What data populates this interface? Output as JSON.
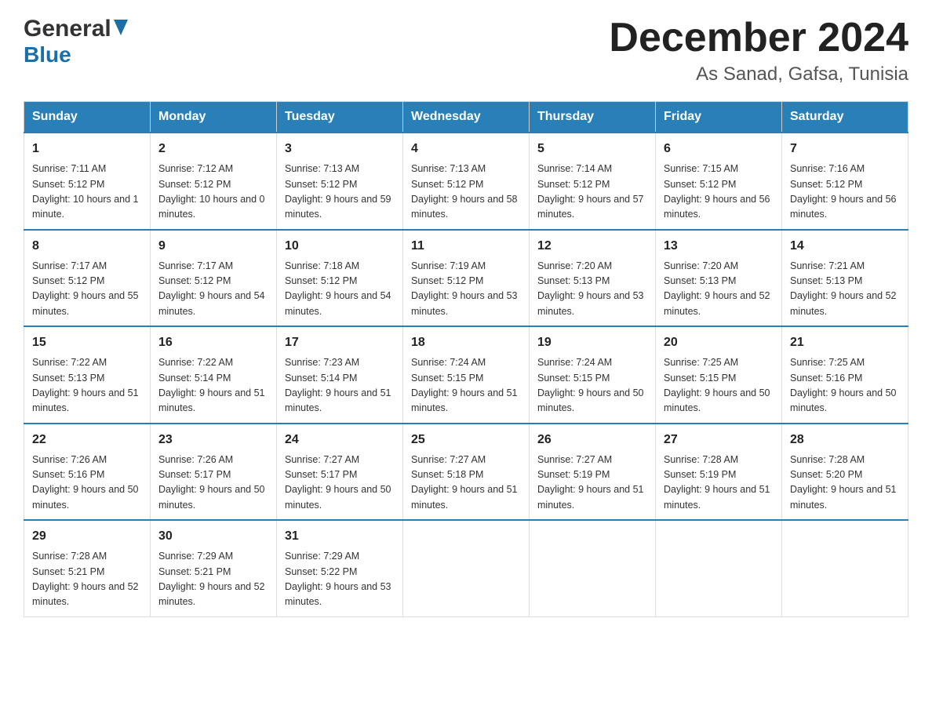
{
  "header": {
    "logo_line1": "General",
    "logo_line2": "Blue",
    "title": "December 2024",
    "subtitle": "As Sanad, Gafsa, Tunisia"
  },
  "days_of_week": [
    "Sunday",
    "Monday",
    "Tuesday",
    "Wednesday",
    "Thursday",
    "Friday",
    "Saturday"
  ],
  "weeks": [
    [
      {
        "day": "1",
        "sunrise": "7:11 AM",
        "sunset": "5:12 PM",
        "daylight": "10 hours and 1 minute."
      },
      {
        "day": "2",
        "sunrise": "7:12 AM",
        "sunset": "5:12 PM",
        "daylight": "10 hours and 0 minutes."
      },
      {
        "day": "3",
        "sunrise": "7:13 AM",
        "sunset": "5:12 PM",
        "daylight": "9 hours and 59 minutes."
      },
      {
        "day": "4",
        "sunrise": "7:13 AM",
        "sunset": "5:12 PM",
        "daylight": "9 hours and 58 minutes."
      },
      {
        "day": "5",
        "sunrise": "7:14 AM",
        "sunset": "5:12 PM",
        "daylight": "9 hours and 57 minutes."
      },
      {
        "day": "6",
        "sunrise": "7:15 AM",
        "sunset": "5:12 PM",
        "daylight": "9 hours and 56 minutes."
      },
      {
        "day": "7",
        "sunrise": "7:16 AM",
        "sunset": "5:12 PM",
        "daylight": "9 hours and 56 minutes."
      }
    ],
    [
      {
        "day": "8",
        "sunrise": "7:17 AM",
        "sunset": "5:12 PM",
        "daylight": "9 hours and 55 minutes."
      },
      {
        "day": "9",
        "sunrise": "7:17 AM",
        "sunset": "5:12 PM",
        "daylight": "9 hours and 54 minutes."
      },
      {
        "day": "10",
        "sunrise": "7:18 AM",
        "sunset": "5:12 PM",
        "daylight": "9 hours and 54 minutes."
      },
      {
        "day": "11",
        "sunrise": "7:19 AM",
        "sunset": "5:12 PM",
        "daylight": "9 hours and 53 minutes."
      },
      {
        "day": "12",
        "sunrise": "7:20 AM",
        "sunset": "5:13 PM",
        "daylight": "9 hours and 53 minutes."
      },
      {
        "day": "13",
        "sunrise": "7:20 AM",
        "sunset": "5:13 PM",
        "daylight": "9 hours and 52 minutes."
      },
      {
        "day": "14",
        "sunrise": "7:21 AM",
        "sunset": "5:13 PM",
        "daylight": "9 hours and 52 minutes."
      }
    ],
    [
      {
        "day": "15",
        "sunrise": "7:22 AM",
        "sunset": "5:13 PM",
        "daylight": "9 hours and 51 minutes."
      },
      {
        "day": "16",
        "sunrise": "7:22 AM",
        "sunset": "5:14 PM",
        "daylight": "9 hours and 51 minutes."
      },
      {
        "day": "17",
        "sunrise": "7:23 AM",
        "sunset": "5:14 PM",
        "daylight": "9 hours and 51 minutes."
      },
      {
        "day": "18",
        "sunrise": "7:24 AM",
        "sunset": "5:15 PM",
        "daylight": "9 hours and 51 minutes."
      },
      {
        "day": "19",
        "sunrise": "7:24 AM",
        "sunset": "5:15 PM",
        "daylight": "9 hours and 50 minutes."
      },
      {
        "day": "20",
        "sunrise": "7:25 AM",
        "sunset": "5:15 PM",
        "daylight": "9 hours and 50 minutes."
      },
      {
        "day": "21",
        "sunrise": "7:25 AM",
        "sunset": "5:16 PM",
        "daylight": "9 hours and 50 minutes."
      }
    ],
    [
      {
        "day": "22",
        "sunrise": "7:26 AM",
        "sunset": "5:16 PM",
        "daylight": "9 hours and 50 minutes."
      },
      {
        "day": "23",
        "sunrise": "7:26 AM",
        "sunset": "5:17 PM",
        "daylight": "9 hours and 50 minutes."
      },
      {
        "day": "24",
        "sunrise": "7:27 AM",
        "sunset": "5:17 PM",
        "daylight": "9 hours and 50 minutes."
      },
      {
        "day": "25",
        "sunrise": "7:27 AM",
        "sunset": "5:18 PM",
        "daylight": "9 hours and 51 minutes."
      },
      {
        "day": "26",
        "sunrise": "7:27 AM",
        "sunset": "5:19 PM",
        "daylight": "9 hours and 51 minutes."
      },
      {
        "day": "27",
        "sunrise": "7:28 AM",
        "sunset": "5:19 PM",
        "daylight": "9 hours and 51 minutes."
      },
      {
        "day": "28",
        "sunrise": "7:28 AM",
        "sunset": "5:20 PM",
        "daylight": "9 hours and 51 minutes."
      }
    ],
    [
      {
        "day": "29",
        "sunrise": "7:28 AM",
        "sunset": "5:21 PM",
        "daylight": "9 hours and 52 minutes."
      },
      {
        "day": "30",
        "sunrise": "7:29 AM",
        "sunset": "5:21 PM",
        "daylight": "9 hours and 52 minutes."
      },
      {
        "day": "31",
        "sunrise": "7:29 AM",
        "sunset": "5:22 PM",
        "daylight": "9 hours and 53 minutes."
      },
      null,
      null,
      null,
      null
    ]
  ]
}
